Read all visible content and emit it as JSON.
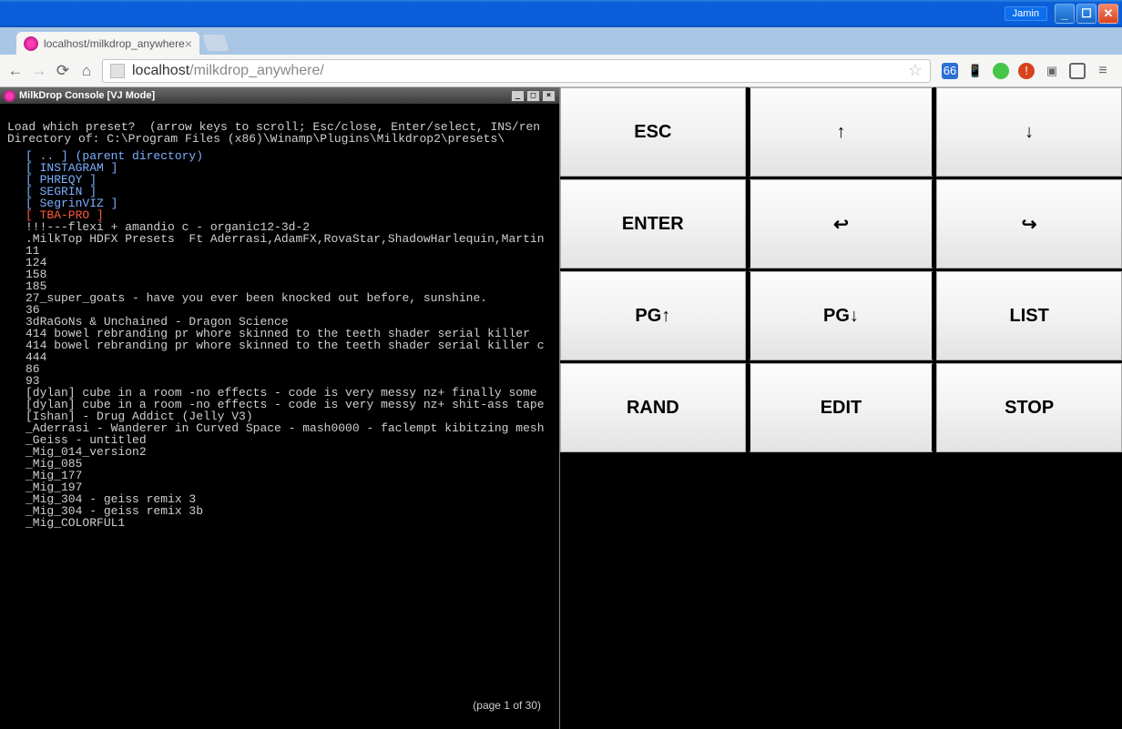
{
  "win": {
    "user": "Jamin"
  },
  "tab": {
    "title": "localhost/milkdrop_anywhere"
  },
  "addr": {
    "host": "localhost",
    "path": "/milkdrop_anywhere/"
  },
  "console": {
    "title": "MilkDrop Console [VJ Mode]",
    "prompt1": "Load which preset?  (arrow keys to scroll; Esc/close, Enter/select, INS/ren",
    "prompt2": "Directory of: C:\\Program Files (x86)\\Winamp\\Plugins\\Milkdrop2\\presets\\",
    "dirs": [
      "[ .. ] (parent directory)",
      "[ INSTAGRAM ]",
      "[ PHREQY ]",
      "[ SEGRIN ]",
      "[ SegrinVIZ ]"
    ],
    "selected": "[ TBA-PRO ]",
    "files": [
      "!!!---flexi + amandio c - organic12-3d-2",
      ".MilkTop HDFX Presets  Ft Aderrasi,AdamFX,RovaStar,ShadowHarlequin,Martin",
      "11",
      "124",
      "158",
      "185",
      "27_super_goats - have you ever been knocked out before, sunshine.",
      "36",
      "3dRaGoNs & Unchained - Dragon Science",
      "414 bowel rebranding pr whore skinned to the teeth shader serial killer",
      "414 bowel rebranding pr whore skinned to the teeth shader serial killer c",
      "444",
      "86",
      "93",
      "[dylan] cube in a room -no effects - code is very messy nz+ finally some",
      "[dylan] cube in a room -no effects - code is very messy nz+ shit-ass tape",
      "[Ishan] - Drug Addict (Jelly V3)",
      "_Aderrasi - Wanderer in Curved Space - mash0000 - faclempt kibitzing mesh",
      "_Geiss - untitled",
      "_Mig_014_version2",
      "_Mig_085",
      "_Mig_177",
      "_Mig_197",
      "_Mig_304 - geiss remix 3",
      "_Mig_304 - geiss remix 3b",
      "_Mig_COLORFUL1"
    ],
    "page": "(page 1 of 30)"
  },
  "buttons": [
    "ESC",
    "↑",
    "↓",
    "ENTER",
    "↩",
    "↪",
    "PG↑",
    "PG↓",
    "LIST",
    "RAND",
    "EDIT",
    "STOP"
  ]
}
